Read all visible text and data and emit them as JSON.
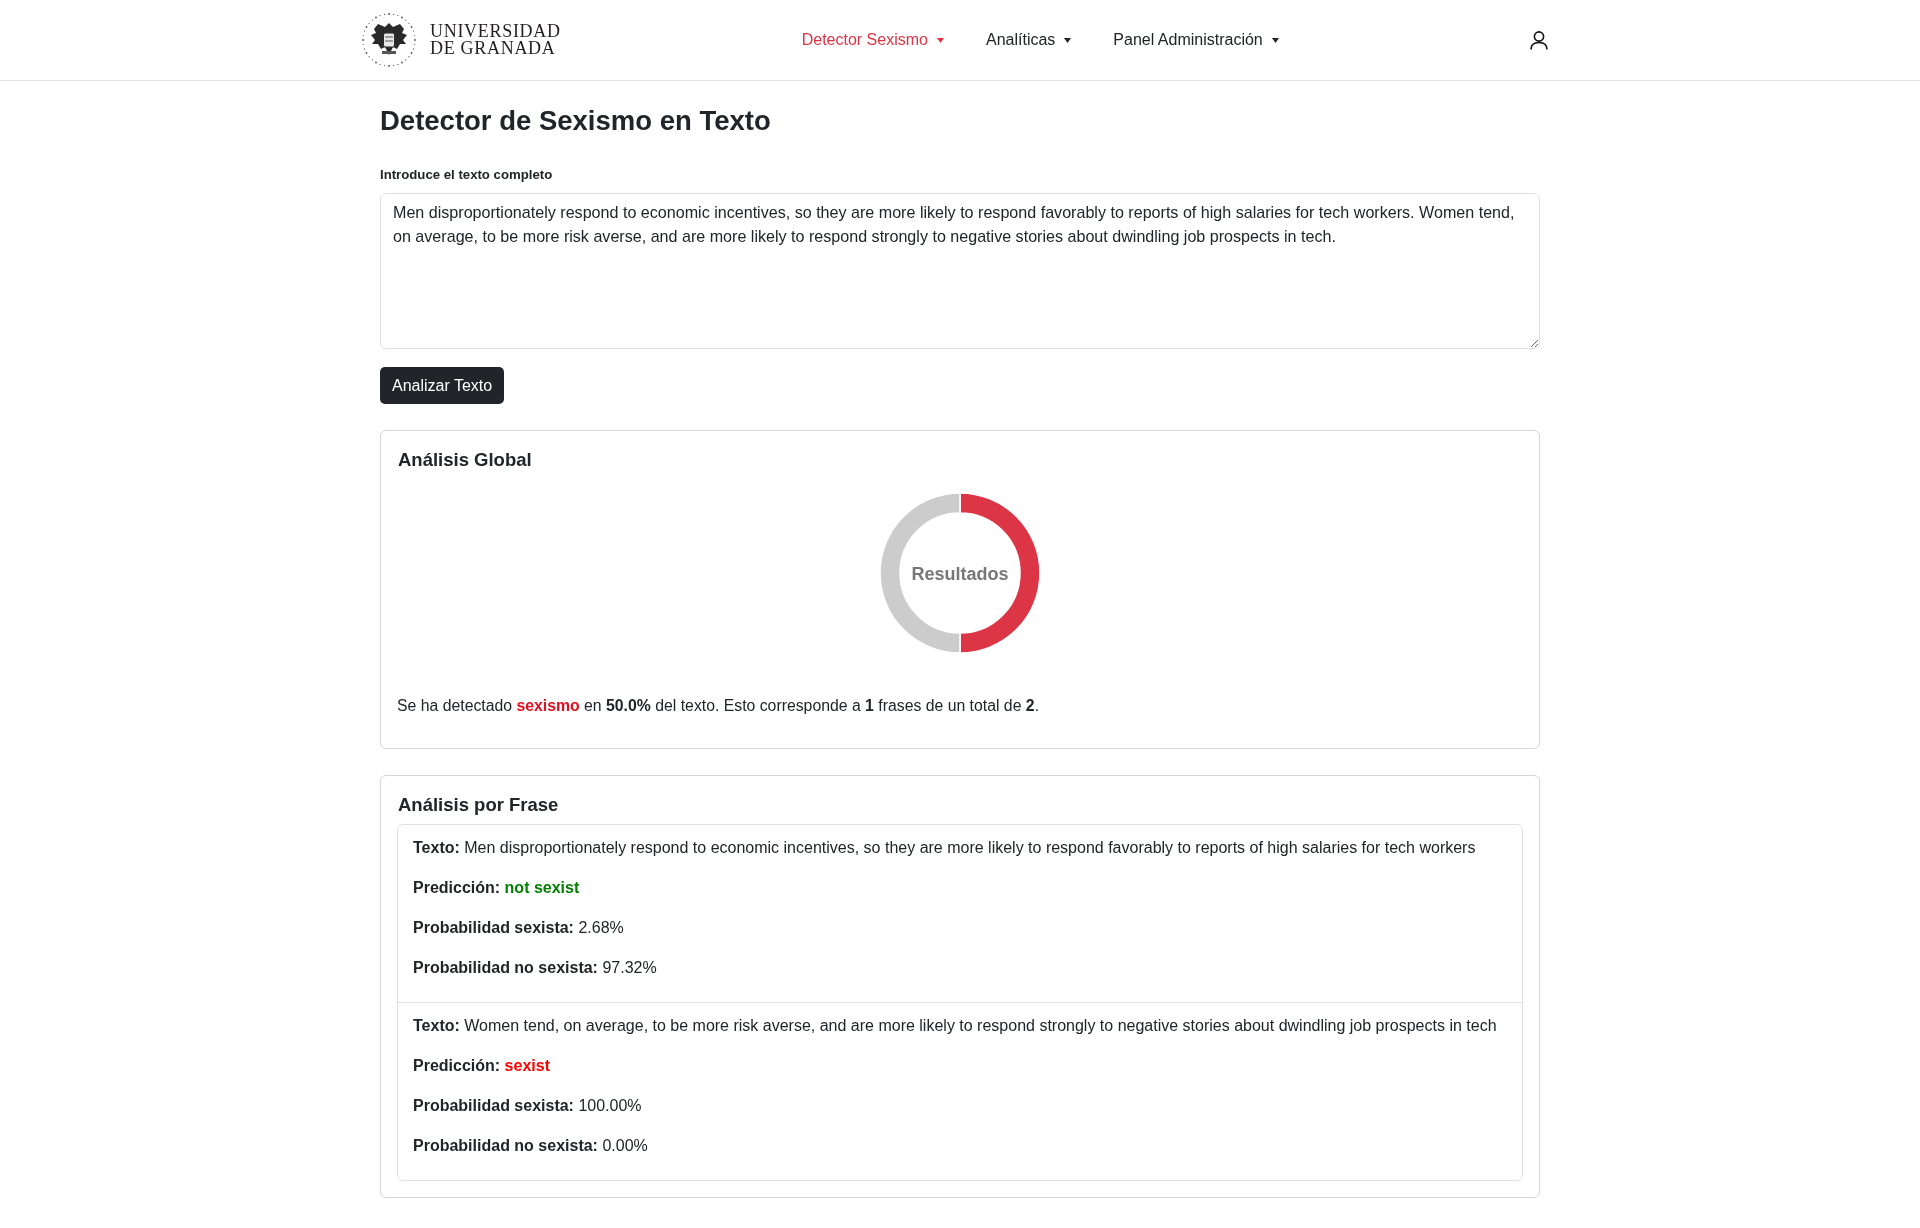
{
  "header": {
    "logo": {
      "lines": [
        "UNIVERSIDAD",
        "DE GRANADA"
      ]
    },
    "nav": [
      {
        "label": "Detector Sexismo",
        "selected": true
      },
      {
        "label": "Analíticas",
        "selected": false
      },
      {
        "label": "Panel Administración",
        "selected": false
      }
    ]
  },
  "page": {
    "title": "Detector de Sexismo en Texto",
    "input": {
      "label": "Introduce el texto completo",
      "value": "Men disproportionately respond to economic incentives, so they are more likely to respond favorably to reports of high salaries for tech workers. Women tend, on average, to be more risk averse, and are more likely to respond strongly to negative stories about dwindling job prospects in tech."
    },
    "button": "Analizar Texto"
  },
  "global": {
    "title": "Análisis Global",
    "chart_data": {
      "type": "donut",
      "title": "Resultados",
      "values": [
        50,
        50
      ]
    },
    "summary": {
      "before": "Se ha detectado",
      "highlight": "sexismo",
      "after": "en **50.0%** del texto. Esto corresponde a **1** frases de un total de **2**."
    }
  },
  "phrases": {
    "title": "Análisis por Frase",
    "items": [
      {
        "sexist": false,
        "fields": [
          {
            "kind": "text",
            "label": "Texto:",
            "value": "Men disproportionately respond to economic incentives, so they are more likely to respond favorably to reports of high salaries for tech workers"
          },
          {
            "kind": "prediction",
            "label": "Predicción:",
            "value": "not sexist"
          },
          {
            "kind": "probability",
            "label": "Probabilidad sexista:",
            "value": "2.68%"
          },
          {
            "kind": "probability",
            "label": "Probabilidad no sexista:",
            "value": "97.32%"
          }
        ]
      },
      {
        "sexist": true,
        "fields": [
          {
            "kind": "text",
            "label": "Texto:",
            "value": "Women tend, on average, to be more risk averse, and are more likely to respond strongly to negative stories about dwindling job prospects in tech"
          },
          {
            "kind": "prediction",
            "label": "Predicción:",
            "value": "sexist"
          },
          {
            "kind": "probability",
            "label": "Probabilidad sexista:",
            "value": "100.00%"
          },
          {
            "kind": "probability",
            "label": "Probabilidad no sexista:",
            "value": "0.00%"
          }
        ]
      }
    ]
  }
}
